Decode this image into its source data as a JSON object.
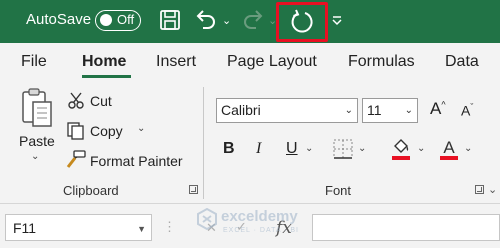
{
  "titlebar": {
    "autosave_label": "AutoSave",
    "autosave_state": "Off",
    "icons": [
      "save-icon",
      "undo-icon",
      "redo-icon",
      "repeat-icon",
      "customize-qat-icon"
    ],
    "background": "#217346",
    "highlight_color": "#e81123"
  },
  "tabs": [
    {
      "label": "File"
    },
    {
      "label": "Home",
      "active": true
    },
    {
      "label": "Insert"
    },
    {
      "label": "Page Layout"
    },
    {
      "label": "Formulas"
    },
    {
      "label": "Data"
    }
  ],
  "clipboard": {
    "paste": "Paste",
    "cut": "Cut",
    "copy": "Copy",
    "format_painter": "Format Painter",
    "group_label": "Clipboard"
  },
  "font": {
    "font_name": "Calibri",
    "font_size": "11",
    "bold": "B",
    "italic": "I",
    "underline": "U",
    "font_color_letter": "A",
    "fill_accent": "#e81123",
    "font_accent": "#e81123",
    "group_label": "Font"
  },
  "formula_bar": {
    "cell_reference": "F11",
    "fx": "fx",
    "formula": ""
  },
  "watermark": {
    "name": "exceldemy",
    "tagline": "EXCEL · DATA · BI"
  }
}
